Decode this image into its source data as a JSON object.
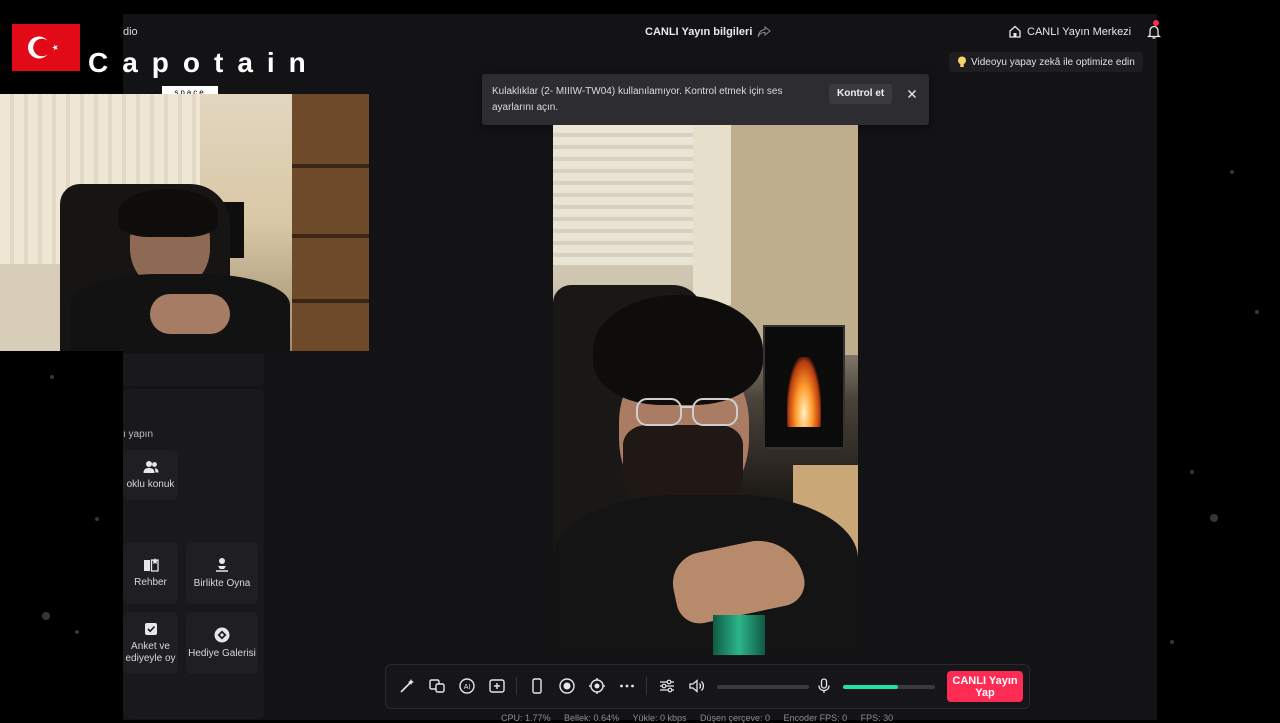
{
  "studio": {
    "app_title_partial": "dio",
    "live_info": "CANLI Yayın bilgileri",
    "live_center": "CANLI Yayın Merkezi",
    "optimize": "Videoyu yapay zekâ ile optimize edin"
  },
  "toast": {
    "message": "Kulaklıklar (2- MIIIW-TW04) kullanılamıyor. Kontrol etmek için ses ayarlarını açın.",
    "button": "Kontrol et"
  },
  "left_panel": {
    "section_label_partial": "ı yapın",
    "tools": [
      {
        "label": "oklu konuk",
        "icon": "users-icon"
      },
      {
        "label": "Rehber",
        "icon": "guide-icon"
      },
      {
        "label": "Birlikte Oyna",
        "icon": "play-together-icon"
      },
      {
        "label": "Anket ve ediyeyle oy",
        "icon": "poll-icon"
      },
      {
        "label": "Hediye Galerisi",
        "icon": "gift-gallery-icon"
      }
    ]
  },
  "controls": {
    "go_live": "CANLI Yayın Yap",
    "volume_level": 0,
    "mic_level": 0.6
  },
  "status": {
    "cpu": "CPU: 1.77%",
    "memory": "Bellek: 0.64%",
    "upload": "Yükle: 0 kbps",
    "dropped": "Düşen çerçeve: 0",
    "encoder_fps": "Encoder FPS: 0",
    "fps": "FPS: 30"
  },
  "overlay": {
    "brand": "Capotain",
    "brand_sub": "space"
  },
  "colors": {
    "accent": "#fe2c55",
    "mic": "#22e0a0",
    "flag": "#e30a17"
  }
}
